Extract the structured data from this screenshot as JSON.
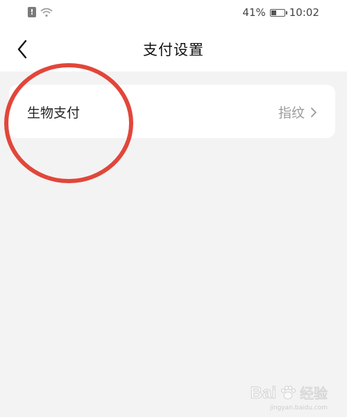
{
  "status_bar": {
    "battery_text": "41%",
    "battery_level": 0.41,
    "time": "10:02",
    "icons": [
      "sim-alert-icon",
      "wifi-icon",
      "battery-icon"
    ]
  },
  "header": {
    "title": "支付设置",
    "back_icon": "chevron-left-icon"
  },
  "settings": {
    "items": [
      {
        "label": "生物支付",
        "value": "指纹",
        "icon": "chevron-right-icon"
      }
    ]
  },
  "annotation": {
    "color": "#e2463a"
  },
  "watermark": {
    "logo": "Bai",
    "text": "经验",
    "sub": "jingyan.baidu.com"
  },
  "colors": {
    "background": "#f3f3f3",
    "card": "#ffffff",
    "text": "#222222",
    "secondary_text": "#9a9a9a"
  }
}
